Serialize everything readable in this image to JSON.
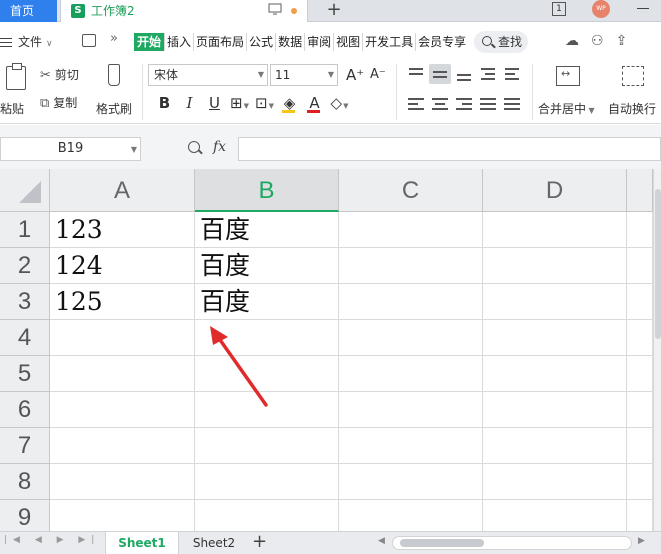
{
  "tabs": {
    "home_label": "首页",
    "doc_title": "工作簿2",
    "doc_icon": "S",
    "add_tab": "+",
    "avatar": "WP"
  },
  "menu": {
    "file_label": "文件",
    "more": "»",
    "items": [
      "开始",
      "插入",
      "页面布局",
      "公式",
      "数据",
      "审阅",
      "视图",
      "开发工具",
      "会员专享"
    ],
    "search_label": "查找"
  },
  "ribbon": {
    "paste_label": "粘贴",
    "cut_label": "剪切",
    "copy_label": "复制",
    "format_painter_label": "格式刷",
    "font_name": "宋体",
    "font_size": "11",
    "bold": "B",
    "italic": "I",
    "underline": "U",
    "size_up": "A⁺",
    "size_down": "A⁻",
    "merge_label": "合并居中",
    "wrap_label": "自动换行",
    "font_color": "#e02020",
    "fill_color": "#f5c518"
  },
  "formula_bar": {
    "cell_ref": "B19",
    "fx": "fx",
    "formula": ""
  },
  "sheet": {
    "columns": [
      "A",
      "B",
      "C",
      "D"
    ],
    "selected_column": "B",
    "rows": [
      "1",
      "2",
      "3",
      "4",
      "5",
      "6",
      "7",
      "8",
      "9"
    ],
    "cells": [
      [
        "123",
        "百度",
        "",
        ""
      ],
      [
        "124",
        "百度",
        "",
        ""
      ],
      [
        "125",
        "百度",
        "",
        ""
      ],
      [
        "",
        "",
        "",
        ""
      ],
      [
        "",
        "",
        "",
        ""
      ],
      [
        "",
        "",
        "",
        ""
      ],
      [
        "",
        "",
        "",
        ""
      ],
      [
        "",
        "",
        "",
        ""
      ],
      [
        "",
        "",
        "",
        ""
      ]
    ],
    "annotation_color": "#e02b2b"
  },
  "sheet_tabs": {
    "active": "Sheet1",
    "other": "Sheet2",
    "add": "+"
  }
}
